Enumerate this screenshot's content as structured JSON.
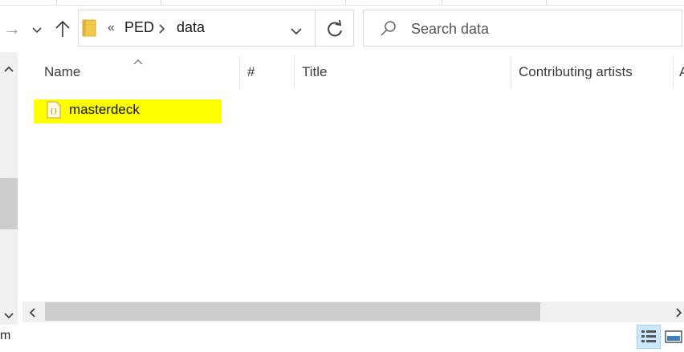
{
  "nav": {
    "forward_icon": "arrow-right-icon",
    "recent_icon": "chevron-down-icon",
    "up_icon": "arrow-up-icon"
  },
  "address": {
    "overflow": "«",
    "crumbs": [
      "PED",
      "data"
    ]
  },
  "search": {
    "placeholder": "Search data"
  },
  "columns": [
    "Name",
    "#",
    "Title",
    "Contributing artists"
  ],
  "files": [
    {
      "name": "masterdeck",
      "icon": "json-file-icon",
      "highlight": "#ffff00"
    }
  ],
  "status": {
    "left_text": "m"
  },
  "colors": {
    "highlight": "#ffff00",
    "selected_view": "#cce8ff"
  }
}
